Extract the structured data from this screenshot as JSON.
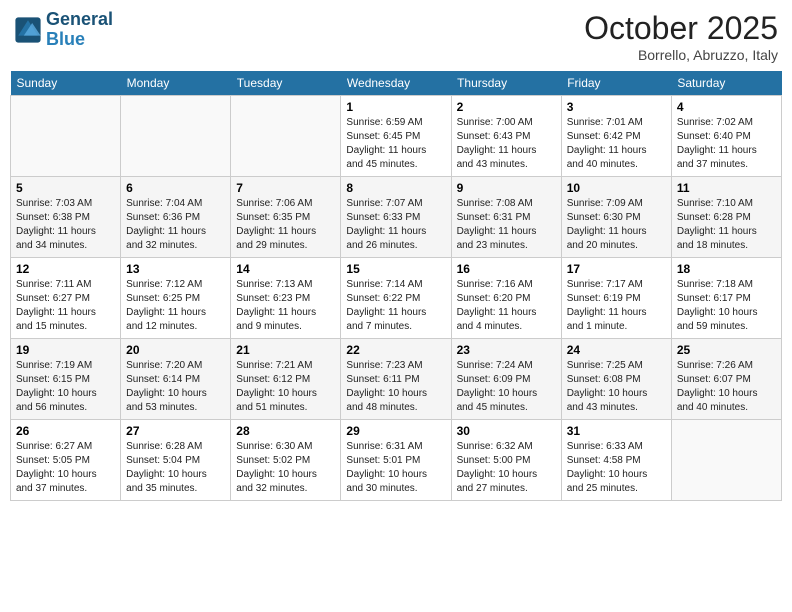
{
  "header": {
    "logo_line1": "General",
    "logo_line2": "Blue",
    "month": "October 2025",
    "location": "Borrello, Abruzzo, Italy"
  },
  "days_of_week": [
    "Sunday",
    "Monday",
    "Tuesday",
    "Wednesday",
    "Thursday",
    "Friday",
    "Saturday"
  ],
  "weeks": [
    [
      {
        "num": "",
        "sunrise": "",
        "sunset": "",
        "daylight": ""
      },
      {
        "num": "",
        "sunrise": "",
        "sunset": "",
        "daylight": ""
      },
      {
        "num": "",
        "sunrise": "",
        "sunset": "",
        "daylight": ""
      },
      {
        "num": "1",
        "sunrise": "Sunrise: 6:59 AM",
        "sunset": "Sunset: 6:45 PM",
        "daylight": "Daylight: 11 hours and 45 minutes."
      },
      {
        "num": "2",
        "sunrise": "Sunrise: 7:00 AM",
        "sunset": "Sunset: 6:43 PM",
        "daylight": "Daylight: 11 hours and 43 minutes."
      },
      {
        "num": "3",
        "sunrise": "Sunrise: 7:01 AM",
        "sunset": "Sunset: 6:42 PM",
        "daylight": "Daylight: 11 hours and 40 minutes."
      },
      {
        "num": "4",
        "sunrise": "Sunrise: 7:02 AM",
        "sunset": "Sunset: 6:40 PM",
        "daylight": "Daylight: 11 hours and 37 minutes."
      }
    ],
    [
      {
        "num": "5",
        "sunrise": "Sunrise: 7:03 AM",
        "sunset": "Sunset: 6:38 PM",
        "daylight": "Daylight: 11 hours and 34 minutes."
      },
      {
        "num": "6",
        "sunrise": "Sunrise: 7:04 AM",
        "sunset": "Sunset: 6:36 PM",
        "daylight": "Daylight: 11 hours and 32 minutes."
      },
      {
        "num": "7",
        "sunrise": "Sunrise: 7:06 AM",
        "sunset": "Sunset: 6:35 PM",
        "daylight": "Daylight: 11 hours and 29 minutes."
      },
      {
        "num": "8",
        "sunrise": "Sunrise: 7:07 AM",
        "sunset": "Sunset: 6:33 PM",
        "daylight": "Daylight: 11 hours and 26 minutes."
      },
      {
        "num": "9",
        "sunrise": "Sunrise: 7:08 AM",
        "sunset": "Sunset: 6:31 PM",
        "daylight": "Daylight: 11 hours and 23 minutes."
      },
      {
        "num": "10",
        "sunrise": "Sunrise: 7:09 AM",
        "sunset": "Sunset: 6:30 PM",
        "daylight": "Daylight: 11 hours and 20 minutes."
      },
      {
        "num": "11",
        "sunrise": "Sunrise: 7:10 AM",
        "sunset": "Sunset: 6:28 PM",
        "daylight": "Daylight: 11 hours and 18 minutes."
      }
    ],
    [
      {
        "num": "12",
        "sunrise": "Sunrise: 7:11 AM",
        "sunset": "Sunset: 6:27 PM",
        "daylight": "Daylight: 11 hours and 15 minutes."
      },
      {
        "num": "13",
        "sunrise": "Sunrise: 7:12 AM",
        "sunset": "Sunset: 6:25 PM",
        "daylight": "Daylight: 11 hours and 12 minutes."
      },
      {
        "num": "14",
        "sunrise": "Sunrise: 7:13 AM",
        "sunset": "Sunset: 6:23 PM",
        "daylight": "Daylight: 11 hours and 9 minutes."
      },
      {
        "num": "15",
        "sunrise": "Sunrise: 7:14 AM",
        "sunset": "Sunset: 6:22 PM",
        "daylight": "Daylight: 11 hours and 7 minutes."
      },
      {
        "num": "16",
        "sunrise": "Sunrise: 7:16 AM",
        "sunset": "Sunset: 6:20 PM",
        "daylight": "Daylight: 11 hours and 4 minutes."
      },
      {
        "num": "17",
        "sunrise": "Sunrise: 7:17 AM",
        "sunset": "Sunset: 6:19 PM",
        "daylight": "Daylight: 11 hours and 1 minute."
      },
      {
        "num": "18",
        "sunrise": "Sunrise: 7:18 AM",
        "sunset": "Sunset: 6:17 PM",
        "daylight": "Daylight: 10 hours and 59 minutes."
      }
    ],
    [
      {
        "num": "19",
        "sunrise": "Sunrise: 7:19 AM",
        "sunset": "Sunset: 6:15 PM",
        "daylight": "Daylight: 10 hours and 56 minutes."
      },
      {
        "num": "20",
        "sunrise": "Sunrise: 7:20 AM",
        "sunset": "Sunset: 6:14 PM",
        "daylight": "Daylight: 10 hours and 53 minutes."
      },
      {
        "num": "21",
        "sunrise": "Sunrise: 7:21 AM",
        "sunset": "Sunset: 6:12 PM",
        "daylight": "Daylight: 10 hours and 51 minutes."
      },
      {
        "num": "22",
        "sunrise": "Sunrise: 7:23 AM",
        "sunset": "Sunset: 6:11 PM",
        "daylight": "Daylight: 10 hours and 48 minutes."
      },
      {
        "num": "23",
        "sunrise": "Sunrise: 7:24 AM",
        "sunset": "Sunset: 6:09 PM",
        "daylight": "Daylight: 10 hours and 45 minutes."
      },
      {
        "num": "24",
        "sunrise": "Sunrise: 7:25 AM",
        "sunset": "Sunset: 6:08 PM",
        "daylight": "Daylight: 10 hours and 43 minutes."
      },
      {
        "num": "25",
        "sunrise": "Sunrise: 7:26 AM",
        "sunset": "Sunset: 6:07 PM",
        "daylight": "Daylight: 10 hours and 40 minutes."
      }
    ],
    [
      {
        "num": "26",
        "sunrise": "Sunrise: 6:27 AM",
        "sunset": "Sunset: 5:05 PM",
        "daylight": "Daylight: 10 hours and 37 minutes."
      },
      {
        "num": "27",
        "sunrise": "Sunrise: 6:28 AM",
        "sunset": "Sunset: 5:04 PM",
        "daylight": "Daylight: 10 hours and 35 minutes."
      },
      {
        "num": "28",
        "sunrise": "Sunrise: 6:30 AM",
        "sunset": "Sunset: 5:02 PM",
        "daylight": "Daylight: 10 hours and 32 minutes."
      },
      {
        "num": "29",
        "sunrise": "Sunrise: 6:31 AM",
        "sunset": "Sunset: 5:01 PM",
        "daylight": "Daylight: 10 hours and 30 minutes."
      },
      {
        "num": "30",
        "sunrise": "Sunrise: 6:32 AM",
        "sunset": "Sunset: 5:00 PM",
        "daylight": "Daylight: 10 hours and 27 minutes."
      },
      {
        "num": "31",
        "sunrise": "Sunrise: 6:33 AM",
        "sunset": "Sunset: 4:58 PM",
        "daylight": "Daylight: 10 hours and 25 minutes."
      },
      {
        "num": "",
        "sunrise": "",
        "sunset": "",
        "daylight": ""
      }
    ]
  ]
}
